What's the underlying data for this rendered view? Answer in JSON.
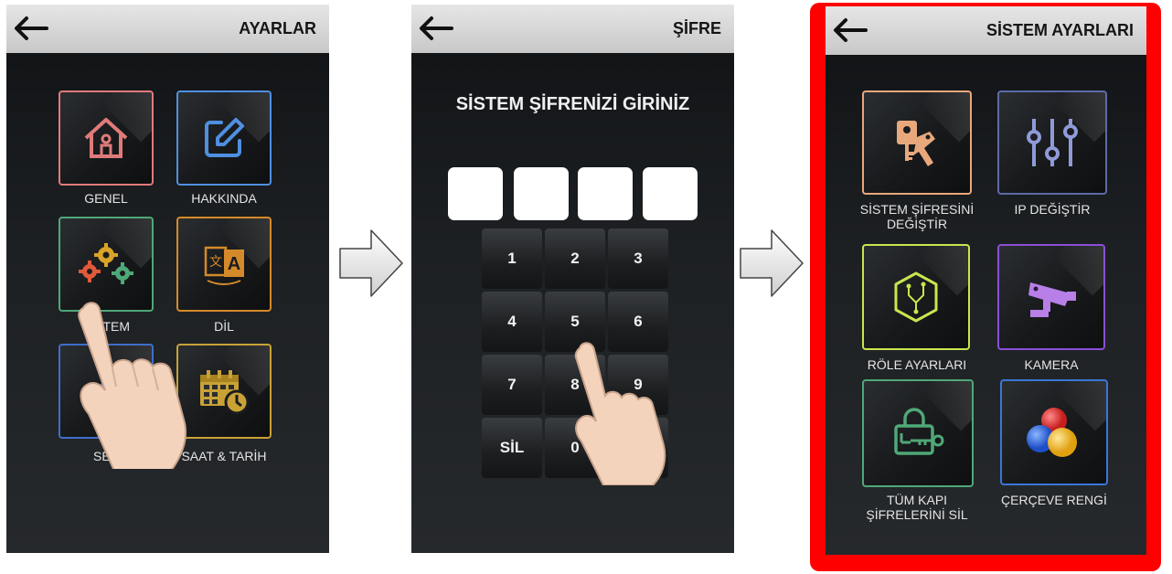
{
  "panel1": {
    "title": "AYARLAR",
    "tiles": [
      {
        "label": "GENEL",
        "icon": "home-icon"
      },
      {
        "label": "HAKKINDA",
        "icon": "edit-icon"
      },
      {
        "label": "SİSTEM",
        "icon": "gears-icon"
      },
      {
        "label": "DİL",
        "icon": "translate-icon"
      },
      {
        "label": "SES",
        "icon": "speaker-icon"
      },
      {
        "label": "SAAT & TARİH",
        "icon": "calendar-clock-icon"
      }
    ]
  },
  "panel2": {
    "title": "ŞİFRE",
    "prompt": "SİSTEM ŞİFRENİZİ GİRİNİZ",
    "keys": [
      "1",
      "2",
      "3",
      "4",
      "5",
      "6",
      "7",
      "8",
      "9",
      "SİL",
      "0",
      ""
    ]
  },
  "panel3": {
    "title": "SİSTEM AYARLARI",
    "tiles": [
      {
        "label1": "SİSTEM ŞİFRESİNİ",
        "label2": "DEĞİŞTİR",
        "icon": "keys-icon"
      },
      {
        "label1": "IP DEĞİŞTİR",
        "icon": "sliders-icon"
      },
      {
        "label1": "RÖLE AYARLARI",
        "icon": "relay-icon"
      },
      {
        "label1": "KAMERA",
        "icon": "camera-icon"
      },
      {
        "label1": "TÜM KAPI",
        "label2": "ŞİFRELERİNİ SİL",
        "icon": "lock-key-icon"
      },
      {
        "label1": "ÇERÇEVE RENGİ",
        "icon": "color-balls-icon"
      }
    ]
  },
  "colors": {
    "highlight": "#ff0000",
    "genel": "#e07b7b",
    "hakkinda": "#4f8fe0",
    "sistem": "#4fa878",
    "dil": "#d48a2a",
    "ses": "#3e6fc8",
    "saat": "#c9a236"
  }
}
